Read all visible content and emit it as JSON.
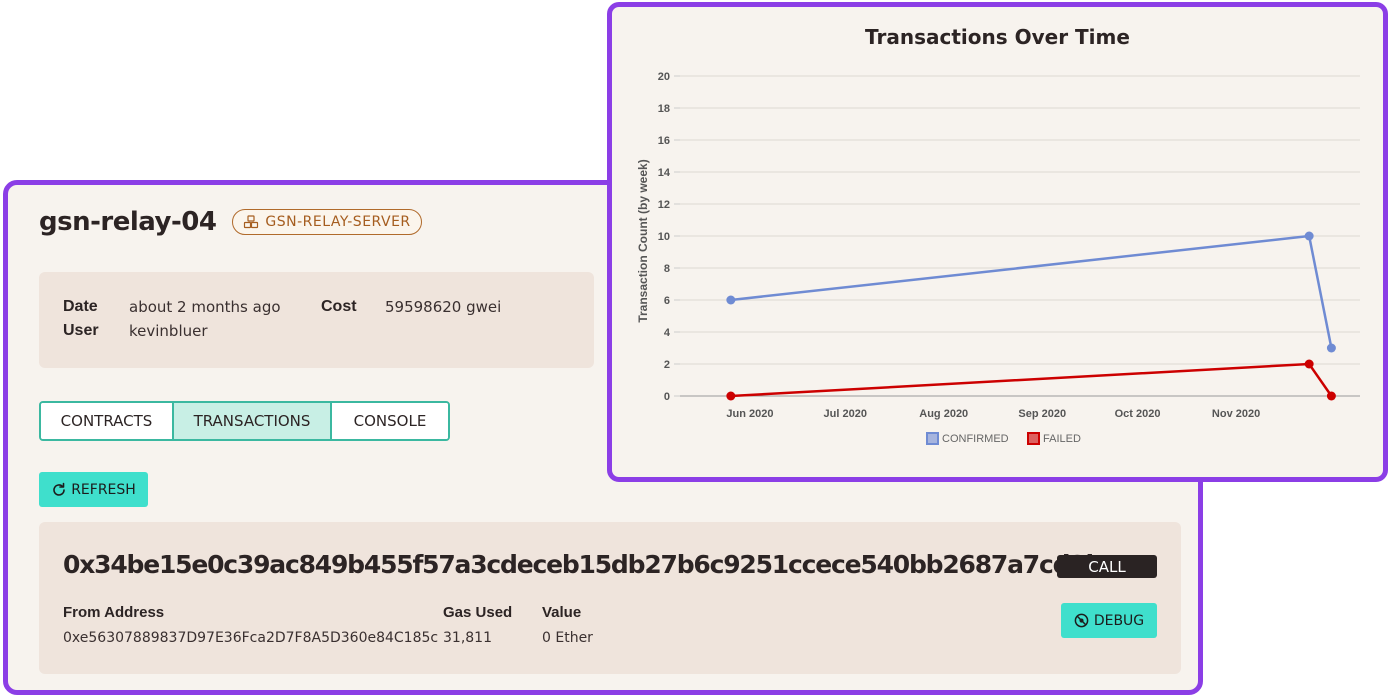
{
  "project": {
    "name": "gsn-relay-04",
    "tag": "GSN-RELAY-SERVER"
  },
  "details": {
    "date_label": "Date",
    "date_value": "about 2 months ago",
    "user_label": "User",
    "user_value": "kevinbluer",
    "cost_label": "Cost",
    "cost_value": "59598620 gwei"
  },
  "tabs": [
    {
      "label": "CONTRACTS",
      "active": false
    },
    {
      "label": "TRANSACTIONS",
      "active": true
    },
    {
      "label": "CONSOLE",
      "active": false
    }
  ],
  "refresh_label": "REFRESH",
  "transaction": {
    "hash": "0x34be15e0c39ac849b455f57a3cdeceb15db27b6c9251ccece540bb2687a7cd3b",
    "type_badge": "CALL",
    "debug_label": "DEBUG",
    "from_label": "From Address",
    "from_value": "0xe56307889837D97E36Fca2D7F8A5D360e84C185c",
    "gas_label": "Gas Used",
    "gas_value": "31,811",
    "value_label": "Value",
    "value_value": "0 Ether"
  },
  "chart_data": {
    "type": "line",
    "title": "Transactions Over Time",
    "xlabel": "",
    "ylabel": "Transaction Count (by week)",
    "ylim": [
      0,
      20
    ],
    "y_ticks": [
      "0",
      "2",
      "4",
      "6",
      "8",
      "10",
      "12",
      "14",
      "16",
      "18",
      "20"
    ],
    "x_ticks": [
      "Jun 2020",
      "Jul 2020",
      "Aug 2020",
      "Sep 2020",
      "Oct 2020",
      "Nov 2020"
    ],
    "x_range": [
      "2020-05-10",
      "2020-12-10"
    ],
    "grid": true,
    "legend": "bottom",
    "series": [
      {
        "name": "CONFIRMED",
        "color": "#6f8bd3",
        "points": [
          {
            "x": "2020-05-26",
            "y": 6
          },
          {
            "x": "2020-11-24",
            "y": 10
          },
          {
            "x": "2020-12-01",
            "y": 3
          }
        ]
      },
      {
        "name": "FAILED",
        "color": "#cc0000",
        "points": [
          {
            "x": "2020-05-26",
            "y": 0
          },
          {
            "x": "2020-11-24",
            "y": 2
          },
          {
            "x": "2020-12-01",
            "y": 0
          }
        ]
      }
    ]
  }
}
